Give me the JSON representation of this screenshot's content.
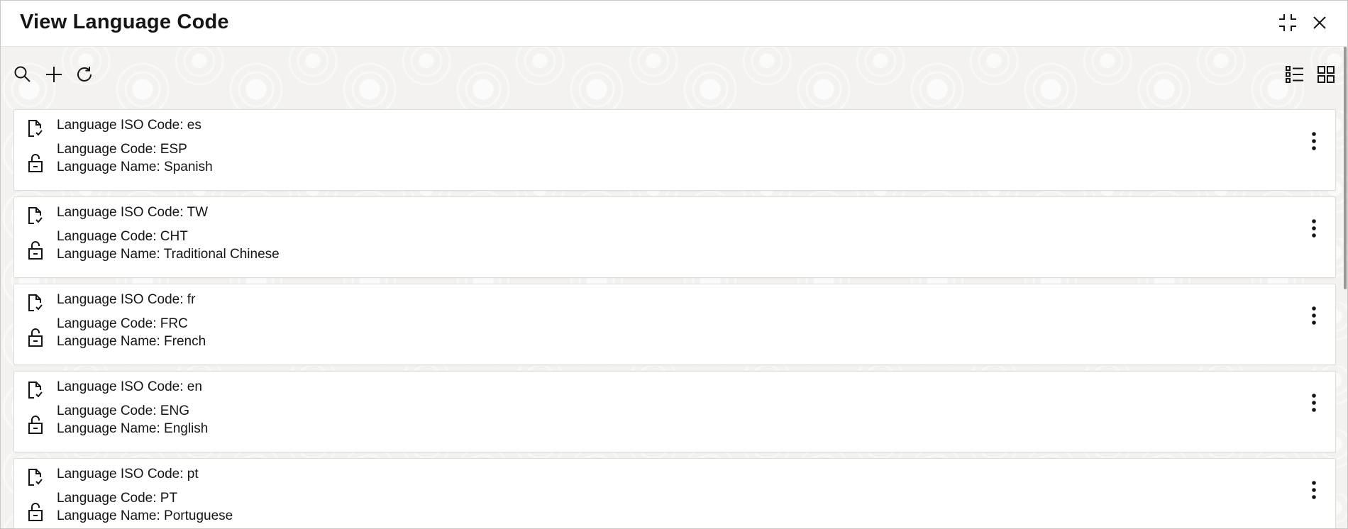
{
  "dialog": {
    "title": "View Language Code",
    "buttons": [
      "minimize-icon",
      "close-icon"
    ]
  },
  "toolbar": {
    "left_icons": [
      "search-icon",
      "add-icon",
      "refresh-icon"
    ],
    "right_icons": [
      "list-view-icon",
      "grid-view-icon"
    ]
  },
  "records": [
    {
      "iso_label": "Language ISO Code: es",
      "code_label": "Language Code: ESP",
      "name_label": "Language Name: Spanish"
    },
    {
      "iso_label": "Language ISO Code: TW",
      "code_label": "Language Code: CHT",
      "name_label": "Language Name: Traditional Chinese"
    },
    {
      "iso_label": "Language ISO Code: fr",
      "code_label": "Language Code: FRC",
      "name_label": "Language Name: French"
    },
    {
      "iso_label": "Language ISO Code: en",
      "code_label": "Language Code: ENG",
      "name_label": "Language Name: English"
    },
    {
      "iso_label": "Language ISO Code: pt",
      "code_label": "Language Code: PT",
      "name_label": "Language Name: Portuguese"
    }
  ],
  "colors": {
    "text": "#161513",
    "background": "#f3f2f0",
    "card": "#ffffff",
    "border": "#dedcd9"
  }
}
